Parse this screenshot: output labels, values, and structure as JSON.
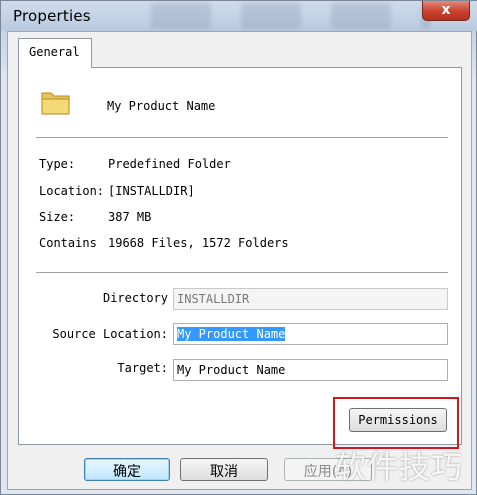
{
  "window": {
    "title": "Properties",
    "close_label": "x"
  },
  "tabs": [
    {
      "label": "General",
      "selected": true
    }
  ],
  "item": {
    "name": "My Product Name",
    "icon": "folder-icon"
  },
  "info": {
    "type_label": "Type:",
    "type_value": "Predefined Folder",
    "location_label": "Location:",
    "location_value": "[INSTALLDIR]",
    "size_label": "Size:",
    "size_value": "387 MB",
    "contains_label": "Contains",
    "contains_value": "19668 Files, 1572 Folders"
  },
  "fields": {
    "directory_identifier_label": "Directory Identifier:",
    "directory_identifier_value": "INSTALLDIR",
    "source_location_label": "Source Location:",
    "source_location_value": "My Product Name",
    "target_label": "Target:",
    "target_value": "My Product Name"
  },
  "permissions_button": "Permissions",
  "footer": {
    "ok": "确定",
    "cancel": "取消",
    "apply": "应用(A)"
  },
  "watermark": "软件技巧",
  "colors": {
    "highlight": "#d4171c",
    "selection": "#3399ff",
    "close": "#c8422d"
  }
}
